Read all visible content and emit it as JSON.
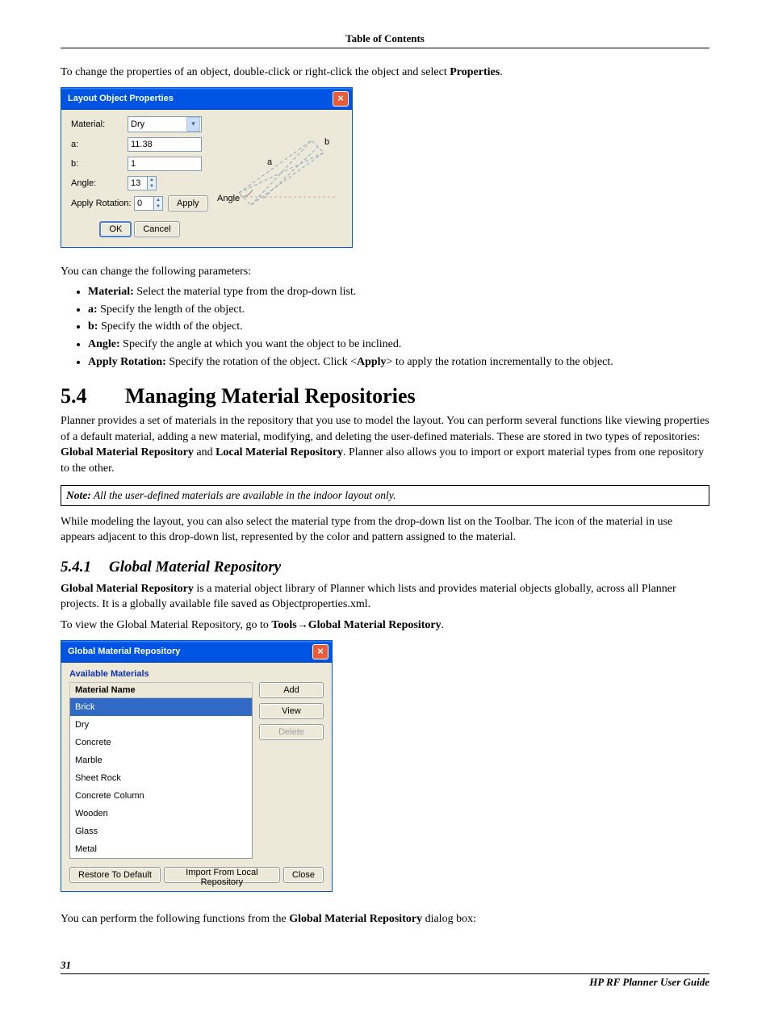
{
  "header": {
    "toc": "Table of Contents"
  },
  "intro": {
    "p1_before": "To change the properties of an object, double-click or right-click the object and select ",
    "p1_bold": "Properties",
    "p1_after": "."
  },
  "dialog1": {
    "title": "Layout Object Properties",
    "labels": {
      "material": "Material:",
      "a": "a:",
      "b": "b:",
      "angle": "Angle:",
      "apply_rotation": "Apply Rotation:"
    },
    "values": {
      "material": "Dry",
      "a": "11.38",
      "b": "1",
      "angle": "13",
      "rotation": "0"
    },
    "buttons": {
      "apply": "Apply",
      "ok": "OK",
      "cancel": "Cancel"
    },
    "diagram": {
      "a": "a",
      "b": "b",
      "angle": "Angle"
    }
  },
  "params": {
    "lead": "You can change the following parameters:",
    "items": [
      {
        "b": "Material:",
        "t": " Select the material type from the drop-down list."
      },
      {
        "b": "a:",
        "t": " Specify the length of the object."
      },
      {
        "b": "b:",
        "t": " Specify the width of the object."
      },
      {
        "b": "Angle:",
        "t": " Specify the angle at which you want the object to be inclined."
      },
      {
        "b": "Apply Rotation:",
        "t": " Specify the rotation of the object. Click <",
        "mid_bold": "Apply",
        "after": "> to apply the rotation incrementally to the object."
      }
    ]
  },
  "sec54": {
    "num": "5.4",
    "title": "Managing Material Repositories",
    "p1a": "Planner provides a set of materials in the repository that you use to model the layout. You can perform several functions like viewing properties of a default material, adding a new material, modifying, and deleting the user-defined materials. These are stored in two types of repositories: ",
    "p1b1": "Global Material Repository",
    "p1mid": " and ",
    "p1b2": "Local Material Repository",
    "p1c": ". Planner also allows you to import or export material types from one repository to the other.",
    "note_label": "Note:",
    "note_text": " All the user-defined materials are available in the indoor layout only.",
    "p2": "While modeling the layout, you can also select the material type from the drop-down list on the Toolbar. The icon of the material in use appears adjacent to this drop-down list, represented by the color and pattern assigned to the material."
  },
  "sec541": {
    "num": "5.4.1",
    "title": "Global Material Repository",
    "p1b": "Global Material Repository",
    "p1": " is a material object library of Planner which lists and provides material objects globally, across all Planner projects. It is a globally available file saved as Objectproperties.xml.",
    "p2a": "To view the Global Material Repository, go to ",
    "p2b1": "Tools",
    "p2arrow": "→",
    "p2b2": "Global Material Repository",
    "p2c": "."
  },
  "dialog2": {
    "title": "Global Material Repository",
    "available": "Available Materials",
    "col": "Material Name",
    "rows": [
      "Brick",
      "Dry",
      "Concrete",
      "Marble",
      "Sheet Rock",
      "Concrete Column",
      "Wooden",
      "Glass",
      "Metal"
    ],
    "selected_index": 0,
    "buttons": {
      "add": "Add",
      "view": "View",
      "delete": "Delete",
      "restore": "Restore To Default",
      "import": "Import From Local Repository",
      "close": "Close"
    }
  },
  "after_dlg2": {
    "p_before": "You can perform the following functions from the ",
    "p_bold": "Global Material Repository",
    "p_after": " dialog box:"
  },
  "footer": {
    "page": "31",
    "guide": "HP RF Planner User Guide"
  }
}
